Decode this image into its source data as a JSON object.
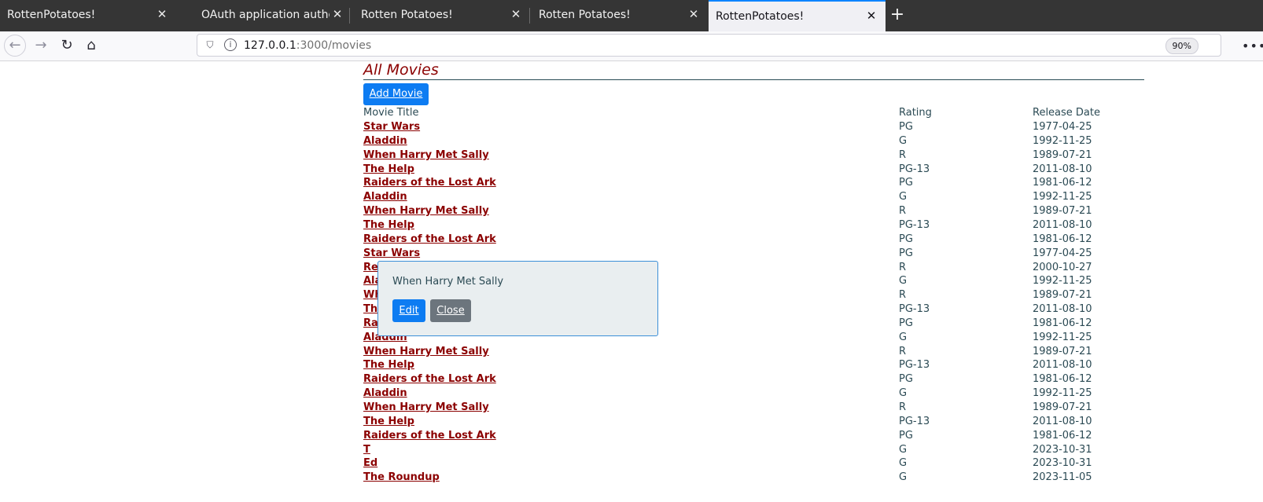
{
  "browser": {
    "tabs": [
      {
        "label": "RottenPotatoes!",
        "active": false
      },
      {
        "label": "OAuth application autho",
        "active": false
      },
      {
        "label": "Rotten Potatoes!",
        "active": false
      },
      {
        "label": "Rotten Potatoes!",
        "active": false
      },
      {
        "label": "RottenPotatoes!",
        "active": true
      }
    ],
    "tab_close_glyph": "✕",
    "new_tab_glyph": "+",
    "url_host": "127.0.0.1",
    "url_path": ":3000/movies",
    "zoom": "90%",
    "menu_glyph": "•••",
    "icons": {
      "back": "←",
      "forward": "→",
      "reload": "↻",
      "home": "⌂",
      "shield": "⛉",
      "info": "i"
    }
  },
  "page": {
    "heading": "All Movies",
    "add_button": "Add Movie",
    "columns": {
      "title": "Movie Title",
      "rating": "Rating",
      "date": "Release Date"
    },
    "movies": [
      {
        "title": "Star Wars",
        "rating": "PG",
        "date": "1977-04-25"
      },
      {
        "title": "Aladdin",
        "rating": "G",
        "date": "1992-11-25"
      },
      {
        "title": "When Harry Met Sally",
        "rating": "R",
        "date": "1989-07-21"
      },
      {
        "title": "The Help",
        "rating": "PG-13",
        "date": "2011-08-10"
      },
      {
        "title": "Raiders of the Lost Ark",
        "rating": "PG",
        "date": "1981-06-12"
      },
      {
        "title": "Aladdin",
        "rating": "G",
        "date": "1992-11-25"
      },
      {
        "title": "When Harry Met Sally",
        "rating": "R",
        "date": "1989-07-21"
      },
      {
        "title": "The Help",
        "rating": "PG-13",
        "date": "2011-08-10"
      },
      {
        "title": "Raiders of the Lost Ark",
        "rating": "PG",
        "date": "1981-06-12"
      },
      {
        "title": "Star Wars",
        "rating": "PG",
        "date": "1977-04-25"
      },
      {
        "title": "Rear Window",
        "rating": "R",
        "date": "2000-10-27"
      },
      {
        "title": "Aladdin",
        "rating": "G",
        "date": "1992-11-25"
      },
      {
        "title": "When Harry Met Sally",
        "rating": "R",
        "date": "1989-07-21"
      },
      {
        "title": "The Help",
        "rating": "PG-13",
        "date": "2011-08-10"
      },
      {
        "title": "Raiders of the Lost Ark",
        "rating": "PG",
        "date": "1981-06-12"
      },
      {
        "title": "Aladdin",
        "rating": "G",
        "date": "1992-11-25"
      },
      {
        "title": "When Harry Met Sally",
        "rating": "R",
        "date": "1989-07-21"
      },
      {
        "title": "The Help",
        "rating": "PG-13",
        "date": "2011-08-10"
      },
      {
        "title": "Raiders of the Lost Ark",
        "rating": "PG",
        "date": "1981-06-12"
      },
      {
        "title": "Aladdin",
        "rating": "G",
        "date": "1992-11-25"
      },
      {
        "title": "When Harry Met Sally",
        "rating": "R",
        "date": "1989-07-21"
      },
      {
        "title": "The Help",
        "rating": "PG-13",
        "date": "2011-08-10"
      },
      {
        "title": "Raiders of the Lost Ark",
        "rating": "PG",
        "date": "1981-06-12"
      },
      {
        "title": "T",
        "rating": "G",
        "date": "2023-10-31"
      },
      {
        "title": "Ed",
        "rating": "G",
        "date": "2023-10-31"
      },
      {
        "title": "The Roundup",
        "rating": "G",
        "date": "2023-11-05"
      }
    ],
    "popup": {
      "title": "When Harry Met Sally",
      "edit": "Edit",
      "close": "Close"
    }
  },
  "colors": {
    "accent": "#0d7cf2",
    "link": "#8b0000",
    "text": "#2b4a54"
  }
}
